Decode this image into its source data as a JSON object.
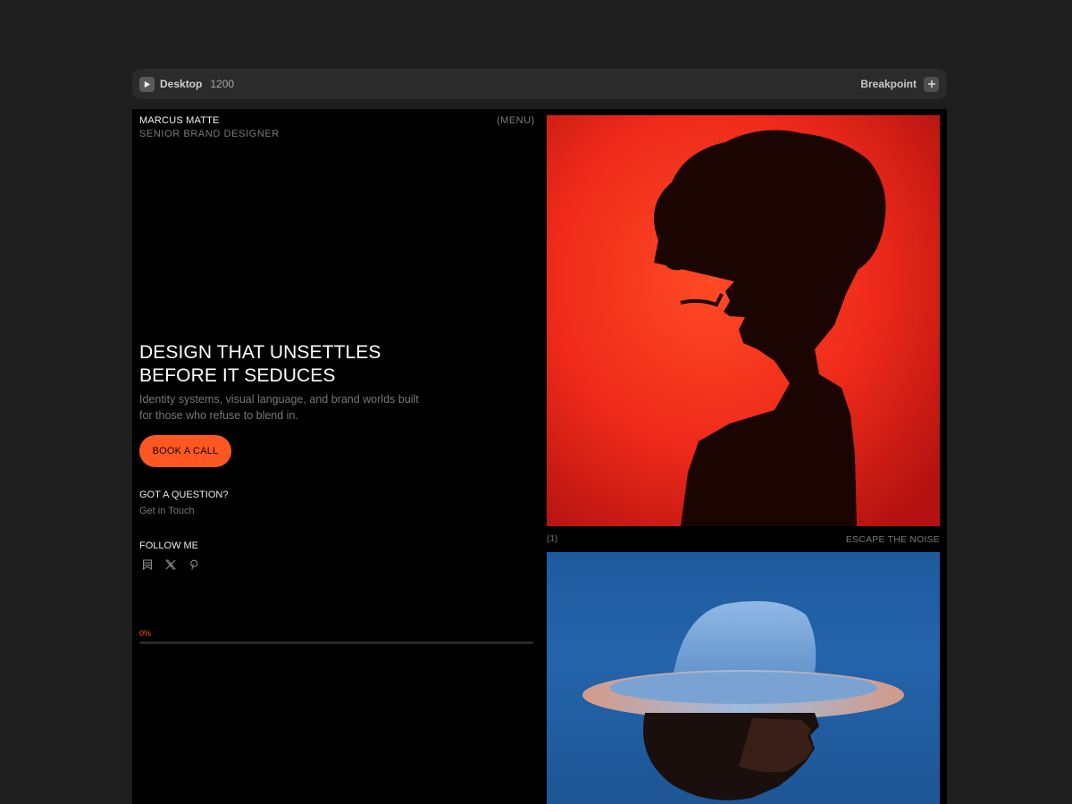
{
  "toolbar": {
    "preview_label": "Desktop",
    "width_value": "1200",
    "breakpoint_label": "Breakpoint"
  },
  "site": {
    "name": "MARCUS MATTE",
    "role": "SENIOR BRAND DESIGNER",
    "menu_label": "(MENU)"
  },
  "hero": {
    "title_line1": "DESIGN THAT UNSETTLES",
    "title_line2": "BEFORE IT SEDUCES",
    "subtitle": "Identity systems, visual language, and brand worlds built for those who refuse to blend in.",
    "cta_label": "BOOK A CALL"
  },
  "contact": {
    "question_title": "GOT A QUESTION?",
    "link_label": "Get in Touch"
  },
  "social": {
    "title": "FOLLOW ME",
    "icons": [
      "bookmark-icon",
      "x-icon",
      "pinterest-icon"
    ]
  },
  "progress": {
    "label": "0%",
    "value": 0
  },
  "gallery": {
    "items": [
      {
        "number": "(1)",
        "caption": "ESCAPE THE NOISE"
      }
    ]
  },
  "colors": {
    "accent": "#ff5722",
    "canvas": "#000000",
    "workspace": "#1e1e1e"
  }
}
